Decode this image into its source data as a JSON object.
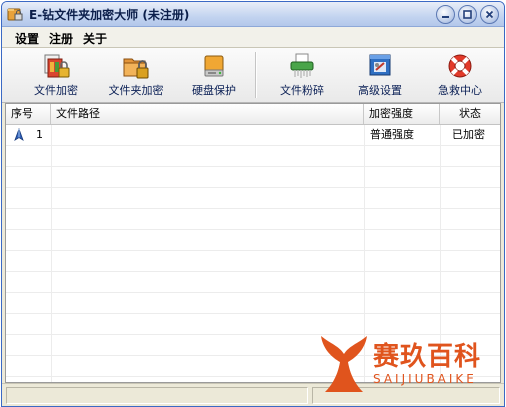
{
  "window": {
    "title": "E-钻文件夹加密大师 (未注册)",
    "icon": "folder-lock-icon",
    "controls": [
      "minimize-icon",
      "maximize-icon",
      "close-icon"
    ]
  },
  "menu": {
    "items": [
      "设置",
      "注册",
      "关于"
    ]
  },
  "toolbar": {
    "buttons": [
      {
        "label": "文件加密",
        "icon": "file-encrypt-icon"
      },
      {
        "label": "文件夹加密",
        "icon": "folder-encrypt-icon"
      },
      {
        "label": "硬盘保护",
        "icon": "disk-protect-icon"
      },
      {
        "label": "文件粉碎",
        "icon": "file-shredder-icon"
      },
      {
        "label": "高级设置",
        "icon": "advanced-settings-icon"
      },
      {
        "label": "急救中心",
        "icon": "lifebuoy-icon"
      }
    ]
  },
  "table": {
    "columns": [
      "序号",
      "文件路径",
      "加密强度",
      "状态"
    ],
    "rows": [
      {
        "index": "1",
        "path": "",
        "strength": "普通强度",
        "status": "已加密",
        "icon": "lock-marker-icon"
      }
    ]
  },
  "watermark": {
    "text_cn": "赛玖百科",
    "text_en": "SAIJIUBAIKE"
  },
  "colors": {
    "title_text": "#0b1e4a",
    "toolbar_label": "#0a1f55",
    "watermark": "#e0541d"
  }
}
